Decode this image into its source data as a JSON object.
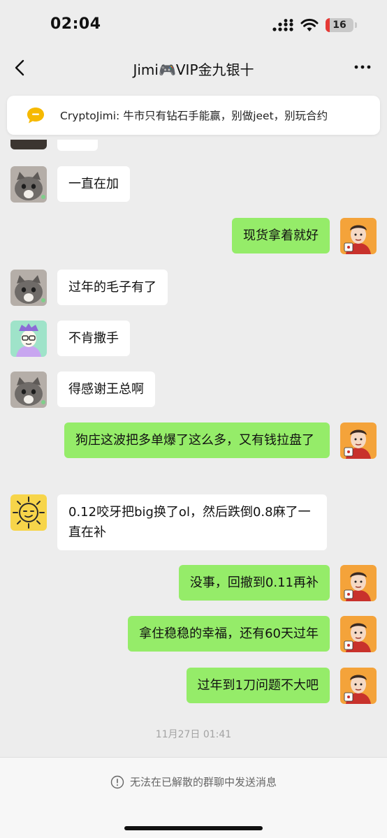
{
  "status_bar": {
    "time": "02:04",
    "battery_level": "16",
    "icons": [
      "cellular-signal-icon",
      "wifi-icon",
      "battery-icon"
    ]
  },
  "nav": {
    "title": "Jimi🎮VIP金九银十",
    "back_icon": "chevron-left-icon",
    "more_icon": "more-dots-icon"
  },
  "pinned": {
    "icon": "speech-bubble-icon",
    "text": "CryptoJimi: 牛市只有钻石手能赢，别做jeet，别玩合约"
  },
  "messages": [
    {
      "side": "in",
      "avatar": "cat-avatar",
      "text": "一直在加"
    },
    {
      "side": "out",
      "avatar": "cartoon-man-avatar",
      "text": "现货拿着就好"
    },
    {
      "side": "in",
      "avatar": "cat-avatar",
      "text": "过年的毛子有了"
    },
    {
      "side": "in",
      "avatar": "pixel-character-avatar",
      "text": "不肯撒手"
    },
    {
      "side": "in",
      "avatar": "cat-avatar",
      "text": "得感谢王总啊"
    },
    {
      "side": "out",
      "avatar": "cartoon-man-avatar",
      "text": "狗庄这波把多单爆了这么多，又有钱拉盘了"
    },
    {
      "side": "in",
      "avatar": "sun-face-avatar",
      "text": "0.12咬牙把big换了ol，然后跌倒0.8麻了一直在补"
    },
    {
      "side": "out",
      "avatar": "cartoon-man-avatar",
      "text": "没事，回撤到0.11再补"
    },
    {
      "side": "out",
      "avatar": "cartoon-man-avatar",
      "text": "拿住稳稳的幸福，还有60天过年"
    },
    {
      "side": "out",
      "avatar": "cartoon-man-avatar",
      "text": "过年到1刀问题不大吧"
    }
  ],
  "timestamp": "11月27日 01:41",
  "footer": {
    "icon": "info-circle-icon",
    "text": "无法在已解散的群聊中发送消息"
  },
  "colors": {
    "background": "#ededed",
    "outgoing_bubble": "#95ec69",
    "incoming_bubble": "#ffffff",
    "pinned_icon": "#f6b900",
    "battery_low": "#e53935"
  }
}
